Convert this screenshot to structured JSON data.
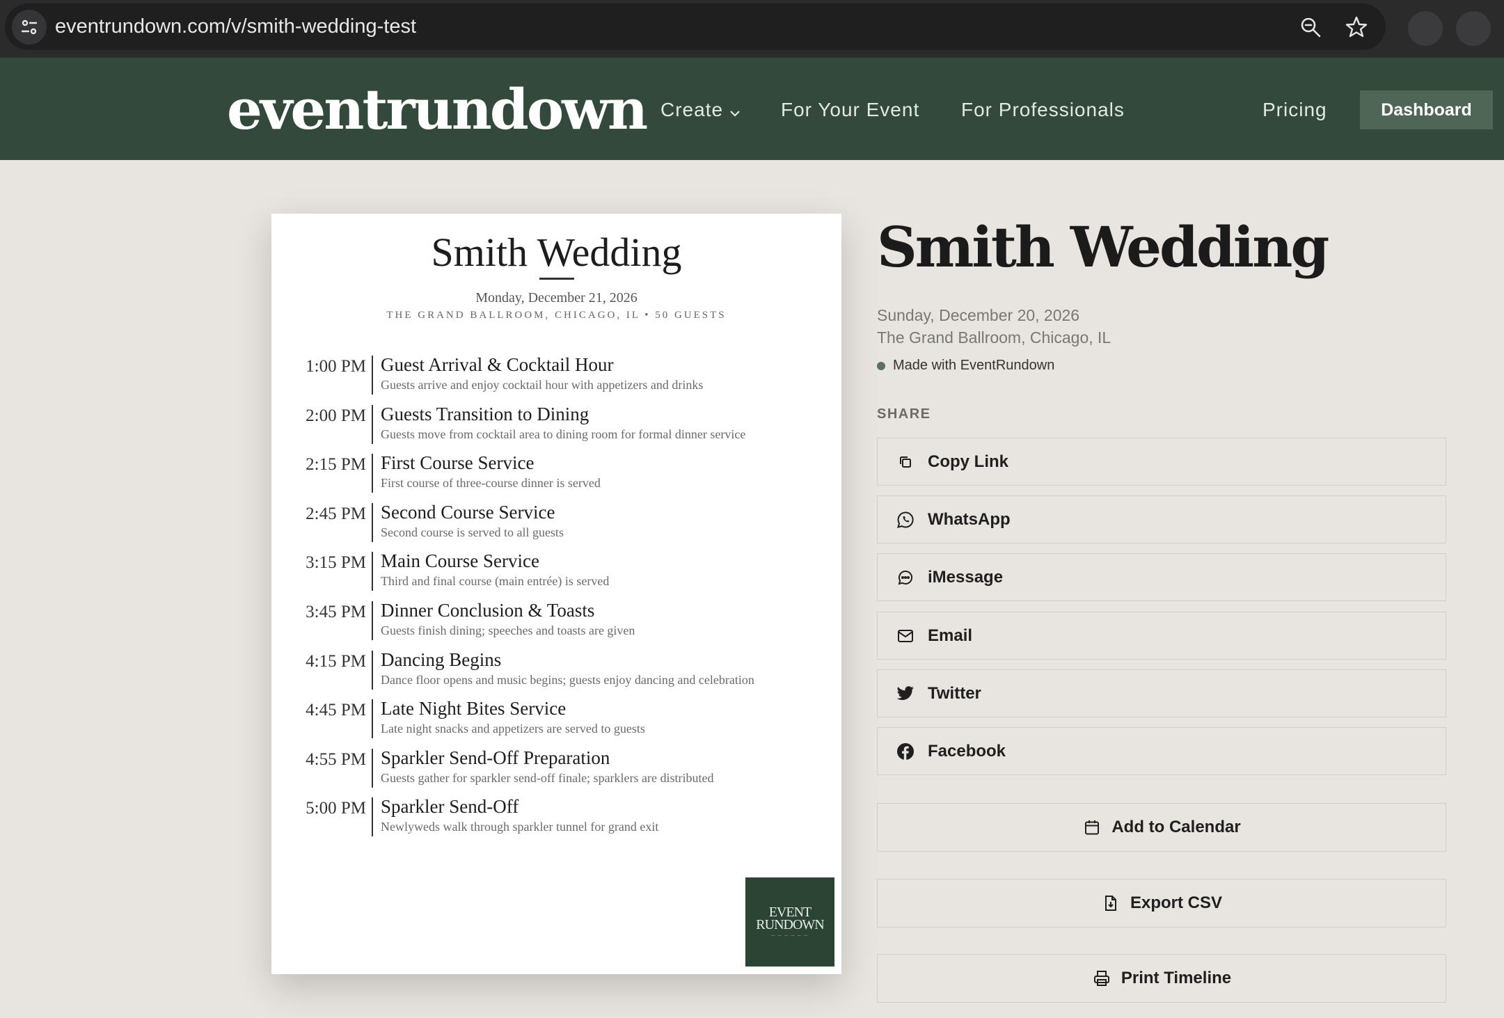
{
  "browser": {
    "url": "eventrundown.com/v/smith-wedding-test"
  },
  "header": {
    "logo": "eventrundown",
    "nav": [
      "Create",
      "For Your Event",
      "For Professionals",
      "Pricing"
    ],
    "dashboard_label": "Dashboard"
  },
  "document": {
    "title": "Smith Wedding",
    "date": "Monday, December 21, 2026",
    "venue_line": "THE GRAND BALLROOM, CHICAGO, IL • 50 GUESTS",
    "timeline": [
      {
        "time": "1:00 PM",
        "title": "Guest Arrival & Cocktail Hour",
        "desc": "Guests arrive and enjoy cocktail hour with appetizers and drinks"
      },
      {
        "time": "2:00 PM",
        "title": "Guests Transition to Dining",
        "desc": "Guests move from cocktail area to dining room for formal dinner service"
      },
      {
        "time": "2:15 PM",
        "title": "First Course Service",
        "desc": "First course of three-course dinner is served"
      },
      {
        "time": "2:45 PM",
        "title": "Second Course Service",
        "desc": "Second course is served to all guests"
      },
      {
        "time": "3:15 PM",
        "title": "Main Course Service",
        "desc": "Third and final course (main entrée) is served"
      },
      {
        "time": "3:45 PM",
        "title": "Dinner Conclusion & Toasts",
        "desc": "Guests finish dining; speeches and toasts are given"
      },
      {
        "time": "4:15 PM",
        "title": "Dancing Begins",
        "desc": "Dance floor opens and music begins; guests enjoy dancing and celebration"
      },
      {
        "time": "4:45 PM",
        "title": "Late Night Bites Service",
        "desc": "Late night snacks and appetizers are served to guests"
      },
      {
        "time": "4:55 PM",
        "title": "Sparkler Send-Off Preparation",
        "desc": "Guests gather for sparkler send-off finale; sparklers are distributed"
      },
      {
        "time": "5:00 PM",
        "title": "Sparkler Send-Off",
        "desc": "Newlyweds walk through sparkler tunnel for grand exit"
      }
    ],
    "badge_line1": "EVENT",
    "badge_line2": "RUNDOWN"
  },
  "event": {
    "title": "Smith Wedding",
    "date": "Sunday, December 20, 2026",
    "location": "The Grand Ballroom, Chicago, IL",
    "made_with": "Made with EventRundown"
  },
  "share": {
    "label": "SHARE",
    "buttons": [
      {
        "label": "Copy Link",
        "icon": "copy-icon"
      },
      {
        "label": "WhatsApp",
        "icon": "whatsapp-icon"
      },
      {
        "label": "iMessage",
        "icon": "message-icon"
      },
      {
        "label": "Email",
        "icon": "mail-icon"
      },
      {
        "label": "Twitter",
        "icon": "twitter-icon"
      },
      {
        "label": "Facebook",
        "icon": "facebook-icon"
      }
    ]
  },
  "actions": {
    "add_to_calendar": "Add to Calendar",
    "export_csv": "Export CSV",
    "print_timeline": "Print Timeline"
  },
  "colors": {
    "header_bg": "#33493b",
    "page_bg": "#e8e5e0",
    "dashboard_bg": "#4f6656"
  }
}
